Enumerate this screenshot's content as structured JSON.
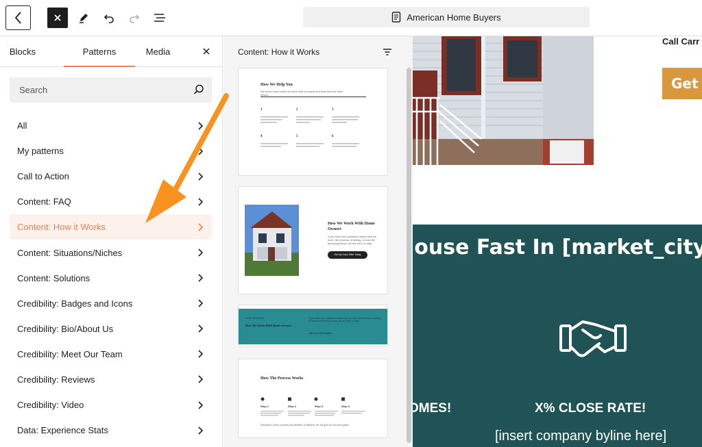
{
  "toolbar": {
    "doc_title": "American Home Buyers"
  },
  "inserter": {
    "tabs": [
      "Blocks",
      "Patterns",
      "Media"
    ],
    "active_tab": "Patterns",
    "search_placeholder": "Search",
    "categories": [
      "All",
      "My patterns",
      "Call to Action",
      "Content: FAQ",
      "Content: How it Works",
      "Content: Situations/Niches",
      "Content: Solutions",
      "Credibility: Badges and Icons",
      "Credibility: Bio/About Us",
      "Credibility: Meet Our Team",
      "Credibility: Reviews",
      "Credibility: Video",
      "Data: Experience Stats"
    ],
    "active_category": "Content: How it Works"
  },
  "patterns": {
    "heading": "Content: How it Works",
    "card1": {
      "title": "How We Help You",
      "intro": "We know every seller we work with is unique and deserves the best option.",
      "steps": [
        "1",
        "2",
        "3",
        "4",
        "5",
        "6"
      ]
    },
    "card2": {
      "title": "How We Work With Home Owners",
      "body": "If you have any questions about how we work, the process of selling, or how the financing works, we are here to help.",
      "button": "Get My Cash Offer Today"
    },
    "card3": {
      "kicker": "HOW WE WORK",
      "title": "How We Work With Home Owners",
      "body": "If you have any questions about how we work, the process of selling, or how the financing works, we are here to help.",
      "link": "Call Us to Get Started"
    },
    "card4": {
      "title": "How The Process Works",
      "steps": [
        "Step 1",
        "Step 2",
        "Step 3",
        "Step 4"
      ],
      "footer": "Disclaimer: Every property and situation is different, we will give you the best option."
    }
  },
  "canvas": {
    "call_text": "Call Carr",
    "cta_button": "Get N",
    "headline": "louse Fast In [market_city]",
    "stat_left": "OMES!",
    "stat_right": "X% CLOSE RATE!",
    "byline": "[insert company byline here]"
  },
  "colors": {
    "accent": "#f0804a",
    "teal": "#1f5356",
    "cta": "#d9983e",
    "annotation_arrow": "#f7931e"
  }
}
